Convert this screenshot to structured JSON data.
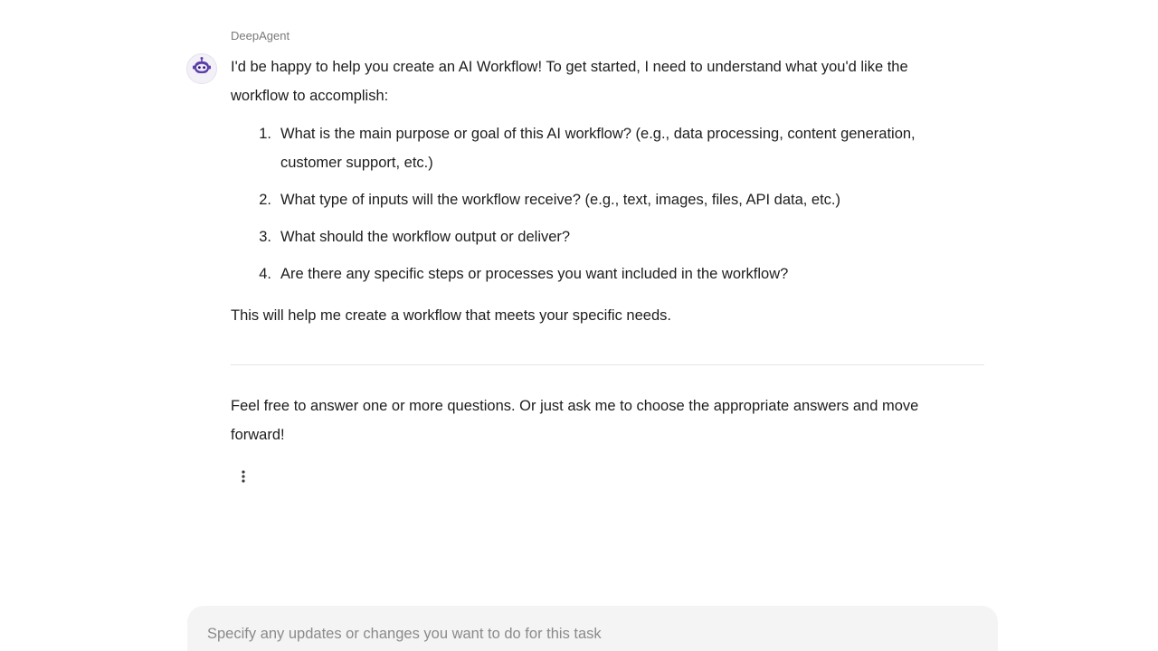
{
  "message": {
    "sender": "DeepAgent",
    "avatar_icon": "robot-icon",
    "intro": "I'd be happy to help you create an AI Workflow! To get started, I need to understand what you'd like the workflow to accomplish:",
    "questions": [
      {
        "number": "1.",
        "text": "What is the main purpose or goal of this AI workflow? (e.g., data processing, content generation, customer support, etc.)"
      },
      {
        "number": "2.",
        "text": "What type of inputs will the workflow receive? (e.g., text, images, files, API data, etc.)"
      },
      {
        "number": "3.",
        "text": "What should the workflow output or deliver?"
      },
      {
        "number": "4.",
        "text": "Are there any specific steps or processes you want included in the workflow?"
      }
    ],
    "closing": "This will help me create a workflow that meets your specific needs.",
    "followup": "Feel free to answer one or more questions. Or just ask me to choose the appropriate answers and move forward!",
    "more_icon": "more-vertical-icon"
  },
  "composer": {
    "placeholder": "Specify any updates or changes you want to do for this task"
  },
  "colors": {
    "accent": "#5b3fa8",
    "input_background": "#f4f4f4"
  }
}
